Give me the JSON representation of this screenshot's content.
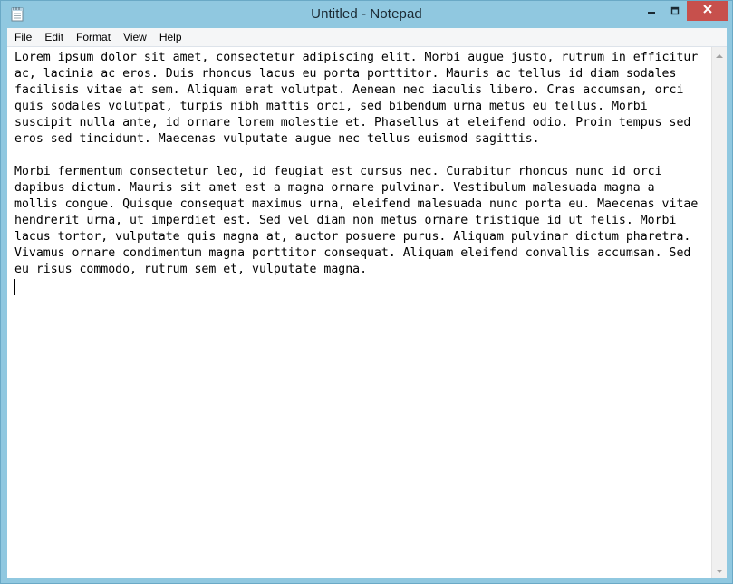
{
  "window": {
    "title": "Untitled - Notepad",
    "icon": "notepad-icon",
    "controls": {
      "minimize_icon": "minimize-icon",
      "maximize_icon": "maximize-icon",
      "close_icon": "close-icon"
    }
  },
  "menubar": {
    "items": [
      {
        "label": "File"
      },
      {
        "label": "Edit"
      },
      {
        "label": "Format"
      },
      {
        "label": "View"
      },
      {
        "label": "Help"
      }
    ]
  },
  "editor": {
    "lines": [
      "Lorem ipsum dolor sit amet, consectetur adipiscing elit. Morbi augue justo, rutrum in efficitur",
      "ac, lacinia ac eros. Duis rhoncus lacus eu porta porttitor. Mauris ac tellus id diam sodales",
      "facilisis vitae at sem. Aliquam erat volutpat. Aenean nec iaculis libero. Cras accumsan, orci",
      "quis sodales volutpat, turpis nibh mattis orci, sed bibendum urna metus eu tellus. Morbi",
      "suscipit nulla ante, id ornare lorem molestie et. Phasellus at eleifend odio. Proin tempus sed",
      "eros sed tincidunt. Maecenas vulputate augue nec tellus euismod sagittis.",
      "",
      "Morbi fermentum consectetur leo, id feugiat est cursus nec. Curabitur rhoncus nunc id orci",
      "dapibus dictum. Mauris sit amet est a magna ornare pulvinar. Vestibulum malesuada magna a",
      "mollis congue. Quisque consequat maximus urna, eleifend malesuada nunc porta eu. Maecenas vitae",
      "hendrerit urna, ut imperdiet est. Sed vel diam non metus ornare tristique id ut felis. Morbi",
      "lacus tortor, vulputate quis magna at, auctor posuere purus. Aliquam pulvinar dictum pharetra.",
      "Vivamus ornare condimentum magna porttitor consequat. Aliquam eleifend convallis accumsan. Sed",
      "eu risus commodo, rutrum sem et, vulputate magna."
    ]
  },
  "colors": {
    "frame": "#90c8e0",
    "close_button": "#c7504c",
    "menubar": "#f5f6f7"
  }
}
